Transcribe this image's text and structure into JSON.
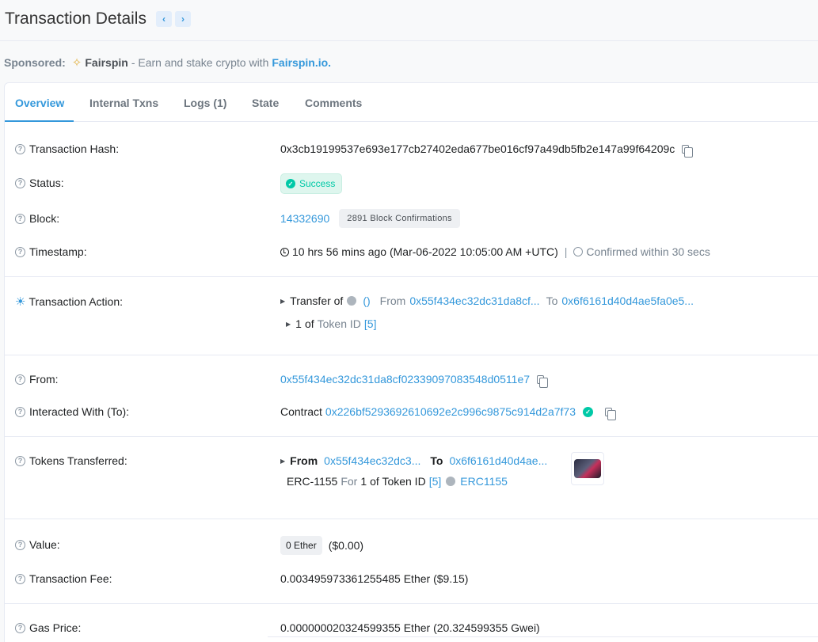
{
  "header": {
    "title": "Transaction Details",
    "prev": "‹",
    "next": "›"
  },
  "sponsor": {
    "label": "Sponsored:",
    "brand": "Fairspin",
    "text": "- Earn and stake crypto with",
    "link": "Fairspin.io."
  },
  "tabs": [
    "Overview",
    "Internal Txns",
    "Logs (1)",
    "State",
    "Comments"
  ],
  "rows": {
    "tx_hash": {
      "label": "Transaction Hash:",
      "value": "0x3cb19199537e693e177cb27402eda677be016cf97a49db5fb2e147a99f64209c"
    },
    "status": {
      "label": "Status:",
      "value": "Success"
    },
    "block": {
      "label": "Block:",
      "number": "14332690",
      "confirmations": "2891 Block Confirmations"
    },
    "timestamp": {
      "label": "Timestamp:",
      "value": "10 hrs 56 mins ago (Mar-06-2022 10:05:00 AM +UTC)",
      "sep": "|",
      "confirmed": "Confirmed within 30 secs"
    },
    "action": {
      "label": "Transaction Action:",
      "transfer_of": "Transfer of",
      "token": "()",
      "from_lbl": "From",
      "from_addr": "0x55f434ec32dc31da8cf...",
      "to_lbl": "To",
      "to_addr": "0x6f6161d40d4ae5fa0e5...",
      "qty": "1",
      "of": "of",
      "token_id": "Token ID",
      "token_id_val": "[5]"
    },
    "from": {
      "label": "From:",
      "value": "0x55f434ec32dc31da8cf02339097083548d0511e7"
    },
    "to": {
      "label": "Interacted With (To):",
      "prefix": "Contract",
      "value": "0x226bf5293692610692e2c996c9875c914d2a7f73"
    },
    "tokens": {
      "label": "Tokens Transferred:",
      "from_lbl": "From",
      "from_addr": "0x55f434ec32dc3...",
      "to_lbl": "To",
      "to_addr": "0x6f6161d40d4ae...",
      "standard": "ERC-1155",
      "for": "For",
      "qty": "1",
      "of_token": "of Token ID",
      "id": "[5]",
      "name": "ERC1155"
    },
    "value": {
      "label": "Value:",
      "ether": "0 Ether",
      "usd": "($0.00)"
    },
    "fee": {
      "label": "Transaction Fee:",
      "value": "0.003495973361255485 Ether ($9.15)"
    },
    "gas": {
      "label": "Gas Price:",
      "value": "0.000000020324599355 Ether (20.324599355 Gwei)"
    }
  }
}
